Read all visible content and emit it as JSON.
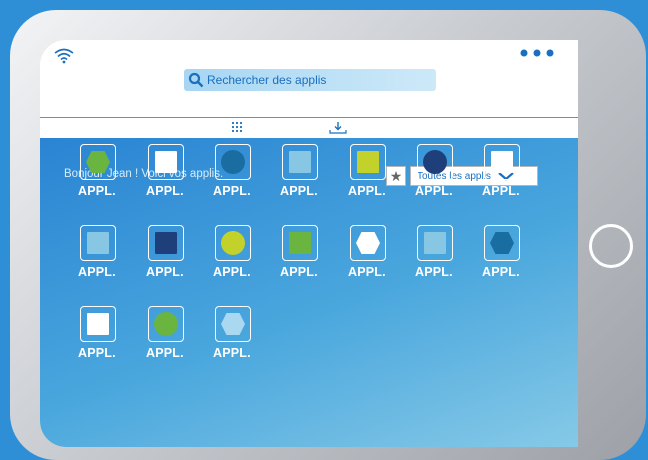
{
  "header": {
    "wifi_icon": "wifi-icon",
    "menu_icon": "more-dots-icon",
    "search": {
      "icon": "search-icon",
      "placeholder": "Rechercher des applis"
    }
  },
  "tabs": [
    {
      "icon": "grid-icon"
    },
    {
      "icon": "download-icon"
    }
  ],
  "content": {
    "greeting": "Bonjour Jean ! Voici vos applis.",
    "filter": {
      "icon": "star-icon",
      "selected": "Toutes les applis",
      "chevron": "chevron-down-icon"
    }
  },
  "colors": {
    "green": "#6ab440",
    "navy": "#1e3f7a",
    "teal": "#1a6da0",
    "light_blue": "#87c7e4",
    "lime": "#c3d22a",
    "white": "#ffffff",
    "pale_blue": "#a9d8f0"
  },
  "apps": [
    {
      "label": "APPL.",
      "shape": "hexagon",
      "color": "#6ab440"
    },
    {
      "label": "APPL.",
      "shape": "square",
      "color": "#ffffff"
    },
    {
      "label": "APPL.",
      "shape": "circle",
      "color": "#1a6da0"
    },
    {
      "label": "APPL.",
      "shape": "square",
      "color": "#87c7e4"
    },
    {
      "label": "APPL.",
      "shape": "square",
      "color": "#c3d22a"
    },
    {
      "label": "APPL.",
      "shape": "circle",
      "color": "#1e3f7a"
    },
    {
      "label": "APPL.",
      "shape": "square",
      "color": "#ffffff"
    },
    {
      "label": "APPL.",
      "shape": "square",
      "color": "#87c7e4"
    },
    {
      "label": "APPL.",
      "shape": "square",
      "color": "#1e3f7a"
    },
    {
      "label": "APPL.",
      "shape": "circle",
      "color": "#c3d22a"
    },
    {
      "label": "APPL.",
      "shape": "square",
      "color": "#6ab440"
    },
    {
      "label": "APPL.",
      "shape": "hexagon",
      "color": "#ffffff"
    },
    {
      "label": "APPL.",
      "shape": "square",
      "color": "#87c7e4"
    },
    {
      "label": "APPL.",
      "shape": "hexagon",
      "color": "#1a6da0"
    },
    {
      "label": "APPL.",
      "shape": "square",
      "color": "#ffffff"
    },
    {
      "label": "APPL.",
      "shape": "circle",
      "color": "#6ab440"
    },
    {
      "label": "APPL.",
      "shape": "hexagon",
      "color": "#a9d8f0"
    }
  ],
  "device": {
    "home_button_icon": "home-button-icon"
  }
}
